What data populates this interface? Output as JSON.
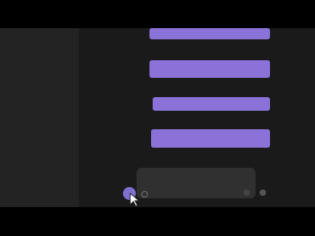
{
  "conversation": {
    "messages": [
      {
        "role": "user",
        "text": ""
      },
      {
        "role": "assistant",
        "text": ""
      },
      {
        "role": "user",
        "text": ""
      },
      {
        "role": "assistant",
        "text": ""
      },
      {
        "role": "user",
        "text": ""
      },
      {
        "role": "assistant",
        "text": ""
      },
      {
        "role": "user",
        "text": ""
      },
      {
        "role": "assistant",
        "text": ""
      }
    ]
  },
  "composer": {
    "text": ""
  },
  "colors": {
    "background": "#1a1a1a",
    "sidebar": "#232323",
    "user_bubble": "#8a72d8",
    "accent_button": "#7f6fd1"
  }
}
